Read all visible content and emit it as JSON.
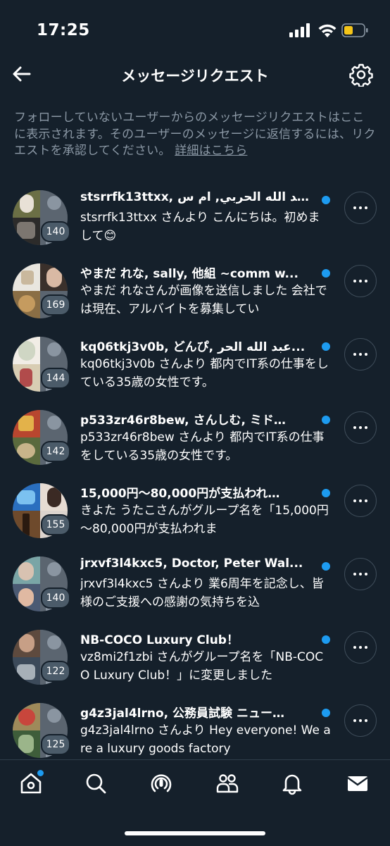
{
  "status_bar": {
    "time": "17:25",
    "battery_color": "#f5c518"
  },
  "header": {
    "title": "メッセージリクエスト",
    "back_icon": "arrow-left-icon",
    "settings_icon": "gear-icon"
  },
  "notice": {
    "text": "フォローしていないユーザーからのメッセージリクエストはここに表示されます。そのユーザーのメッセージに返信するには、リクエストを承認してください。",
    "link": "詳細はこちら"
  },
  "requests": [
    {
      "name": "stsrrfk13ttxx, عبد الله الحربي, ام س...",
      "preview": "stsrrfk13ttxx さんより こんにちは。初めまして😊",
      "count": "140"
    },
    {
      "name": "やまだ れな, sally, 他組 ~comm w...",
      "preview": "やまだ れなさんが画像を送信しました 会社では現在、アルバイトを募集してい",
      "count": "169"
    },
    {
      "name": "kq06tkj3v0b, どんぴ, عبد الله الحر...",
      "preview": "kq06tkj3v0b さんより 都内でIT系の仕事をしている35歳の女性です。",
      "count": "144"
    },
    {
      "name": "p533zr46r8bew, さんしむ, ミド…",
      "preview": "p533zr46r8bew さんより 都内でIT系の仕事をしている35歳の女性です。",
      "count": "142"
    },
    {
      "name": "15,000円～80,000円が支払われ…",
      "preview": "きよた うたこさんがグループ名を「15,000円～80,000円が支払われま",
      "count": "155"
    },
    {
      "name": "jrxvf3l4kxc5, Doctor, Peter Wal...",
      "preview": "jrxvf3l4kxc5 さんより 業6周年を記念し、皆様のご支援への感謝の気持ちを込",
      "count": "140"
    },
    {
      "name": "NB-COCO Luxury Club！",
      "preview": "vz8mi2f1zbi さんがグループ名を「NB-COCO Luxury Club！」に変更しました",
      "count": "122"
    },
    {
      "name": "g4z3jal4lrno, 公務員試験 ニュー…",
      "preview": "g4z3jal4lrno さんより Hey everyone! We are a luxury goods factory",
      "count": "125"
    }
  ],
  "nav": {
    "items": [
      "home-icon",
      "search-icon",
      "spaces-icon",
      "communities-icon",
      "notifications-icon",
      "messages-icon"
    ],
    "accent": "#1d9bf0"
  }
}
